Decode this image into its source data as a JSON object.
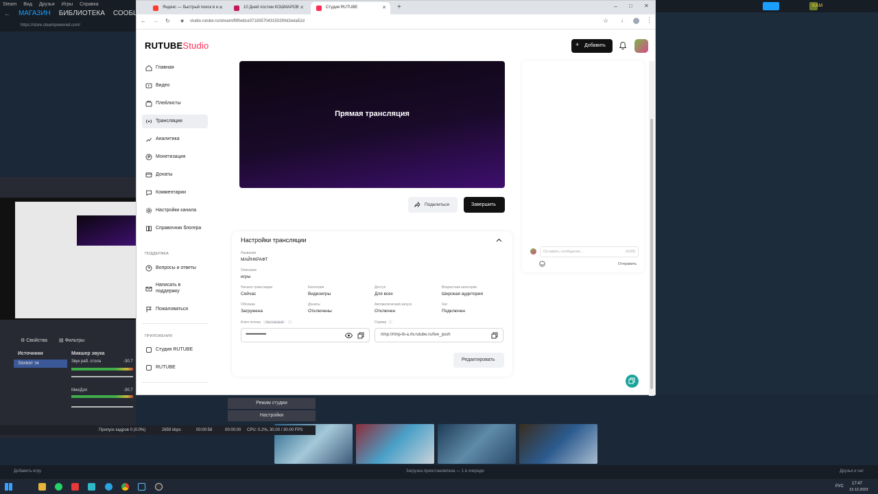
{
  "steam": {
    "menu": [
      "Steam",
      "Вид",
      "Друзья",
      "Игры",
      "Справка"
    ],
    "nav": [
      "МАГАЗИН",
      "БИБЛИОТЕКА",
      "СООБЩ"
    ],
    "url": "https://store.steampowered.com/",
    "user": "KAM",
    "add_game": "Добавить игру",
    "download_status": "Загрузка приостановлена — 1 в очереди",
    "friends": "Друзья и чат"
  },
  "browser": {
    "tabs": [
      {
        "label": "Яндекс — быстрый поиск в и...",
        "color": "#ff3b30",
        "active": false
      },
      {
        "label": "10 Дней постим КОШМАРОВ",
        "color": "#c2185b",
        "active": false
      },
      {
        "label": "Студия RUTUBE",
        "color": "#ff2d55",
        "active": true
      }
    ],
    "url": "studio.rutube.ru/stream/f9f0eb1e0718357043150290d2eda52d"
  },
  "rutube": {
    "logo": "RUTUBE",
    "logo_studio": "Studio",
    "add_button": "Добавить",
    "sidebar": [
      {
        "label": "Главная",
        "icon": "home-icon"
      },
      {
        "label": "Видео",
        "icon": "video-icon"
      },
      {
        "label": "Плейлисты",
        "icon": "playlist-icon"
      },
      {
        "label": "Трансляции",
        "icon": "broadcast-icon",
        "active": true
      },
      {
        "label": "Аналитика",
        "icon": "analytics-icon"
      },
      {
        "label": "Монетизация",
        "icon": "monetization-icon"
      },
      {
        "label": "Донаты",
        "icon": "donate-icon"
      },
      {
        "label": "Комментарии",
        "icon": "comment-icon"
      },
      {
        "label": "Настройки канала",
        "icon": "gear-icon"
      },
      {
        "label": "Справочник блогера",
        "icon": "book-icon"
      }
    ],
    "support_header": "ПОДДЕРЖКА",
    "support": [
      {
        "label": "Вопросы и ответы",
        "icon": "question-icon"
      },
      {
        "label": "Написать в поддержку",
        "icon": "mail-icon"
      },
      {
        "label": "Пожаловаться",
        "icon": "flag-icon"
      }
    ],
    "apps_header": "ПРИЛОЖЕНИЯ",
    "apps": [
      {
        "label": "Студия RUTUBE",
        "icon": "studio-icon"
      },
      {
        "label": "RUTUBE",
        "icon": "rutube-icon"
      }
    ],
    "player_title": "Прямая трансляция",
    "share_button": "Поделиться",
    "finish_button": "Завершить",
    "settings": {
      "title": "Настройки трансляции",
      "name_label": "Название",
      "name": "МАЙНКРАФТ",
      "description_label": "Описание",
      "description": "игры",
      "fields": [
        {
          "label": "Начало трансляции",
          "value": "Сейчас"
        },
        {
          "label": "Категория",
          "value": "Видеоигры"
        },
        {
          "label": "Доступ",
          "value": "Для всех"
        },
        {
          "label": "Возрастная категория",
          "value": "Широкая аудитория"
        },
        {
          "label": "Обложка",
          "value": "Загружена"
        },
        {
          "label": "Донаты",
          "value": "Отключены"
        },
        {
          "label": "Автоматический запуск",
          "value": "Отключен"
        },
        {
          "label": "Чат",
          "value": "Подключен"
        }
      ],
      "key_label": "Ключ потока",
      "key_badge": "Постоянный",
      "key_value": "••••••••••••••••••••••••••••••••••••••••••••••••",
      "server_label": "Сервер",
      "server_value": "rtmp://rtmp-lb-a.rtv.rutube.ru/live_push",
      "edit_button": "Редактировать"
    },
    "chat": {
      "placeholder": "Оставить сообщение...",
      "counter": "0/200",
      "send": "Отправить"
    }
  },
  "obs": {
    "tabs": [
      "Свойства",
      "Фильтры"
    ],
    "sources_header": "Источники",
    "source_item": "Захват эк",
    "mixer_header": "Микшер звука",
    "audio1": "Звук раб. стола",
    "audio2": "Мик/Доп",
    "db1": "-30.7",
    "db2": "-30.7",
    "studio_mode": "Режим студии",
    "settings": "Настройки",
    "status": {
      "dropped": "Пропуск кадров 0 (0.0%)",
      "bitrate": "2659 kbps",
      "rec_time": "00:00:58",
      "stream_time": "00:00:00",
      "cpu": "CPU: 0.2%, 30.00 / 30.00 FPS"
    }
  },
  "clock": {
    "time": "17:47",
    "date": "13.12.2023",
    "lang": "РУС"
  }
}
